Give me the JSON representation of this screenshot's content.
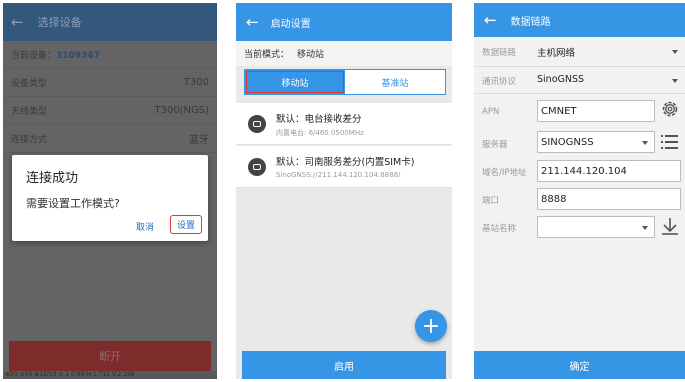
{
  "screen1": {
    "header_title": "选择设备",
    "rows": [
      {
        "label": "当前设备：",
        "value": "3109347"
      },
      {
        "label": "设备类型",
        "value": "T300"
      },
      {
        "label": "天线类型",
        "value": "T300(NGS)"
      },
      {
        "label": "连接方式",
        "value": "蓝牙"
      }
    ],
    "dialog": {
      "title": "连接成功",
      "message": "需要设置工作模式?",
      "cancel": "取消",
      "confirm": "设置"
    },
    "disconnect": "断开",
    "status_bar": "⊕20 ⊙59 ⊕12/19   ⊙ 1   0.99 H:1.715 V:2.198"
  },
  "screen2": {
    "header_title": "启动设置",
    "mode_label": "当前模式：",
    "mode_value": "移动站",
    "tab_rover": "移动站",
    "tab_base": "基准站",
    "cards": [
      {
        "title": "默认：电台接收差分",
        "subtitle": "内置电台: 6/460.0500MHz"
      },
      {
        "title": "默认：司南服务差分(内置SIM卡)",
        "subtitle": "SinoGNSS://211.144.120.104:8888/"
      }
    ],
    "fab": "+",
    "enable": "启用"
  },
  "screen3": {
    "header_title": "数据链路",
    "data_link_label": "数据链路",
    "data_link_value": "主机网络",
    "protocol_label": "通讯协议",
    "protocol_value": "SinoGNSS",
    "apn_label": "APN",
    "apn_value": "CMNET",
    "server_label": "服务器",
    "server_value": "SINOGNSS",
    "domain_label": "域名/IP地址",
    "domain_value": "211.144.120.104",
    "port_label": "端口",
    "port_value": "8888",
    "base_name_label": "基站名称",
    "base_name_value": "",
    "confirm": "确定"
  }
}
